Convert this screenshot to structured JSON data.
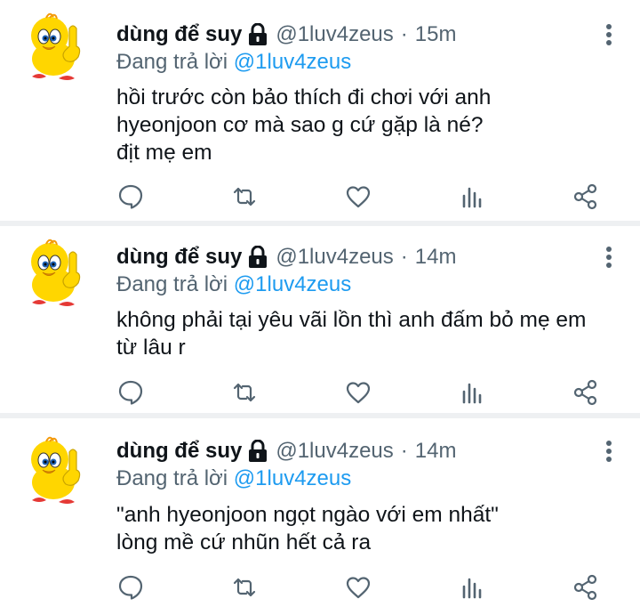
{
  "tweets": [
    {
      "name": "dùng để suy",
      "handle": "@1luv4zeus",
      "separator": "·",
      "time": "15m",
      "reply_prefix": "Đang trả lời",
      "reply_to": "@1luv4zeus",
      "lines": [
        "hồi trước còn bảo thích đi chơi với anh",
        "hyeonjoon cơ mà sao g cứ gặp là né?",
        "địt mẹ em"
      ]
    },
    {
      "name": "dùng để suy",
      "handle": "@1luv4zeus",
      "separator": "·",
      "time": "14m",
      "reply_prefix": "Đang trả lời",
      "reply_to": "@1luv4zeus",
      "lines": [
        "không phải tại yêu vãi lồn thì anh đấm bỏ mẹ em",
        "từ lâu r"
      ]
    },
    {
      "name": "dùng để suy",
      "handle": "@1luv4zeus",
      "separator": "·",
      "time": "14m",
      "reply_prefix": "Đang trả lời",
      "reply_to": "@1luv4zeus",
      "lines": [
        "\"anh hyeonjoon ngọt ngào với em nhất\"",
        "lòng mề cứ nhũn hết cả ra"
      ]
    }
  ],
  "icons": {
    "avatar": "cartoon-bird-avatar-icon",
    "lock": "lock-icon",
    "more": "more-vertical-icon",
    "reply": "reply-icon",
    "retweet": "retweet-icon",
    "like": "like-icon",
    "views": "views-icon",
    "share": "share-icon"
  },
  "colors": {
    "text": "#0f1419",
    "secondary": "#536471",
    "mention": "#1d9bf0",
    "separator": "#eef0f2",
    "avatar_yellow": "#ffd600",
    "avatar_orange": "#f39a0a",
    "avatar_red": "#e53935"
  }
}
